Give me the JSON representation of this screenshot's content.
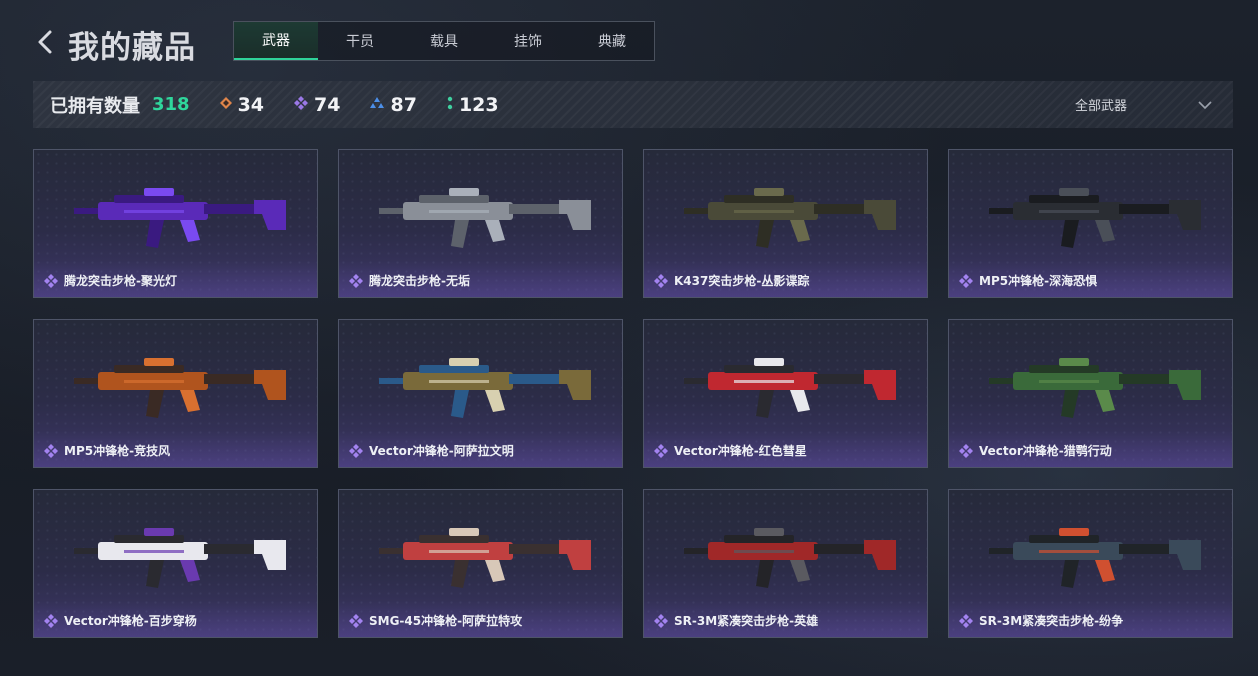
{
  "header": {
    "title": "我的藏品",
    "tabs": [
      {
        "label": "武器",
        "active": true
      },
      {
        "label": "干员",
        "active": false
      },
      {
        "label": "载具",
        "active": false
      },
      {
        "label": "挂饰",
        "active": false
      },
      {
        "label": "典藏",
        "active": false
      }
    ]
  },
  "summary": {
    "label": "已拥有数量",
    "total": "318",
    "stats": [
      {
        "icon": "orange-diamond-icon",
        "color": "#e0854a",
        "value": "34"
      },
      {
        "icon": "purple-diamond-icon",
        "color": "#9a78e6",
        "value": "74"
      },
      {
        "icon": "blue-triangle-icon",
        "color": "#4c8fe8",
        "value": "87"
      },
      {
        "icon": "green-dots-icon",
        "color": "#3fd0a0",
        "value": "123"
      }
    ],
    "filter": "全部武器"
  },
  "items": [
    {
      "name": "腾龙突击步枪-聚光灯",
      "colors": [
        "#5a2ab8",
        "#3a1a80",
        "#7a4af0"
      ]
    },
    {
      "name": "腾龙突击步枪-无垢",
      "colors": [
        "#8a8f98",
        "#5d626b",
        "#aab0ba"
      ]
    },
    {
      "name": "K437突击步枪-丛影谍踪",
      "colors": [
        "#4a4a38",
        "#2e2e24",
        "#6a6a4c"
      ]
    },
    {
      "name": "MP5冲锋枪-深海恐惧",
      "colors": [
        "#2a2d33",
        "#1a1c20",
        "#4a4f58"
      ]
    },
    {
      "name": "MP5冲锋枪-竞技风",
      "colors": [
        "#b0541e",
        "#3a2a24",
        "#d87030"
      ]
    },
    {
      "name": "Vector冲锋枪-阿萨拉文明",
      "colors": [
        "#7a6a3a",
        "#2a5a8a",
        "#d8d0b0"
      ]
    },
    {
      "name": "Vector冲锋枪-红色彗星",
      "colors": [
        "#c02830",
        "#2a2a30",
        "#e8e8ec"
      ]
    },
    {
      "name": "Vector冲锋枪-猎鹗行动",
      "colors": [
        "#3a6a3a",
        "#243a26",
        "#5a8a4a"
      ]
    },
    {
      "name": "Vector冲锋枪-百步穿杨",
      "colors": [
        "#e8e8ee",
        "#2a2a30",
        "#6a3ab0"
      ]
    },
    {
      "name": "SMG-45冲锋枪-阿萨拉特攻",
      "colors": [
        "#c04040",
        "#3a3030",
        "#d8c8b8"
      ]
    },
    {
      "name": "SR-3M紧凑突击步枪-英雄",
      "colors": [
        "#a02828",
        "#242428",
        "#5a5a60"
      ]
    },
    {
      "name": "SR-3M紧凑突击步枪-纷争",
      "colors": [
        "#3a4a5a",
        "#202428",
        "#d05030"
      ]
    }
  ],
  "rarity_color": "#a383f0"
}
